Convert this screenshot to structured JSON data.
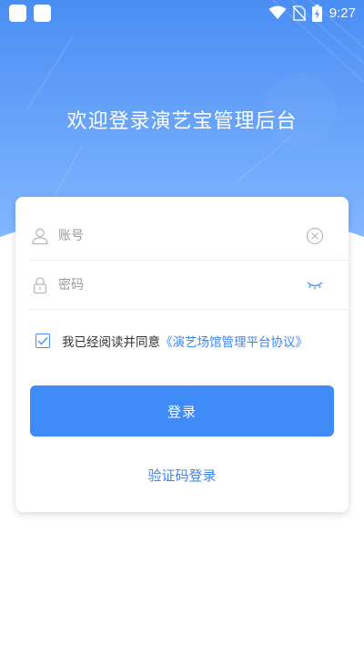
{
  "status_bar": {
    "time": "9:27",
    "icons": [
      "app-icon",
      "app-icon",
      "wifi-icon",
      "no-sim-icon",
      "battery-charging-icon"
    ]
  },
  "header": {
    "title": "欢迎登录演艺宝管理后台"
  },
  "form": {
    "account": {
      "placeholder": "账号",
      "value": ""
    },
    "password": {
      "placeholder": "密码",
      "value": ""
    },
    "agreement": {
      "checked": true,
      "text": "我已经阅读并同意",
      "link": "《演艺场馆管理平台协议》"
    },
    "login_label": "登录",
    "sms_login_label": "验证码登录"
  },
  "colors": {
    "primary": "#3f8bf8",
    "hero_top": "#4f93f4",
    "hero_bottom": "#7fb4ff",
    "link": "#3d84f4",
    "icon_gray": "#b8b8b8"
  }
}
